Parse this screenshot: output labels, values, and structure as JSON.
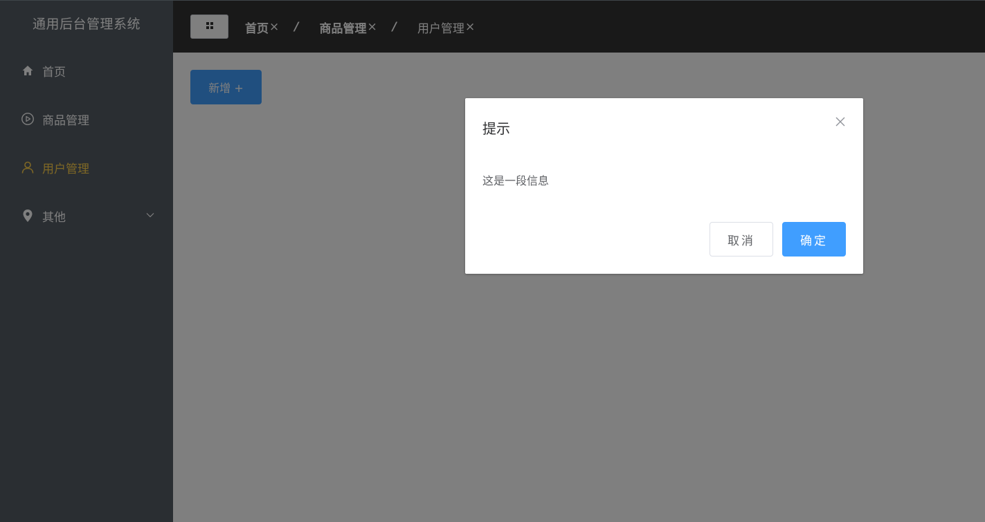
{
  "sidebar": {
    "title": "通用后台管理系统",
    "items": [
      {
        "label": "首页",
        "icon": "home-icon"
      },
      {
        "label": "商品管理",
        "icon": "play-circle-icon"
      },
      {
        "label": "用户管理",
        "icon": "user-icon",
        "active": true
      },
      {
        "label": "其他",
        "icon": "location-icon",
        "has_submenu": true
      }
    ]
  },
  "header": {
    "toggle_icon": "grid-icon",
    "breadcrumb": [
      {
        "label": "首页",
        "close": "×"
      },
      {
        "label": "商品管理",
        "close": "×"
      },
      {
        "label": "用户管理",
        "close": "×"
      }
    ],
    "separator": "/"
  },
  "main": {
    "add_button_label": "新增 +"
  },
  "dialog": {
    "title": "提示",
    "message": "这是一段信息",
    "cancel_label": "取消",
    "confirm_label": "确定"
  },
  "colors": {
    "sidebar_bg": "#545c64",
    "header_bg": "#333333",
    "accent": "#409eff",
    "active_menu": "#ffd04b",
    "overlay": "rgba(0,0,0,0.5)"
  }
}
